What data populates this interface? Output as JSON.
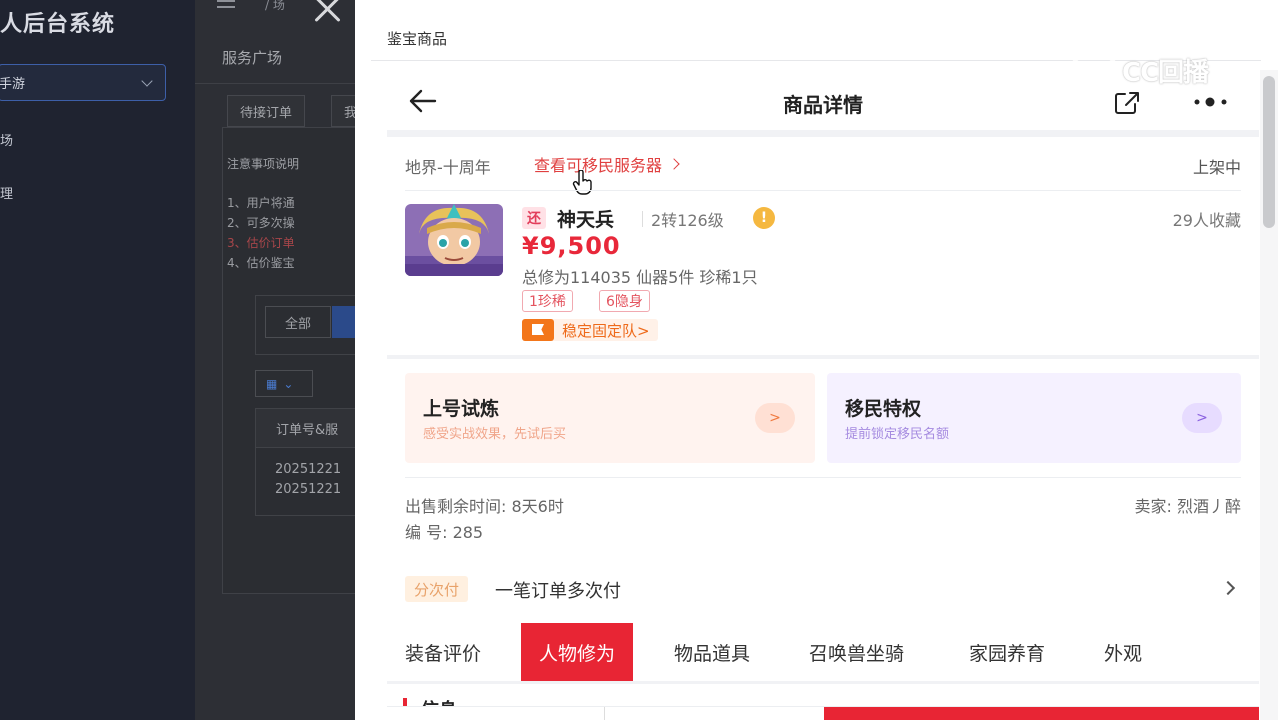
{
  "admin": {
    "title": "人后台系统",
    "game_select": "手游",
    "side_items": [
      "场",
      "理"
    ],
    "breadcrumb": "/ 场",
    "section_title": "服务广场",
    "tabs": [
      "待接订单",
      "我"
    ],
    "notice_title": "注意事项说明",
    "notices": [
      "1、用户将通",
      "2、可多次操",
      "3、估价订单",
      "4、估价鉴宝"
    ],
    "filter_all": "全部",
    "table_header": "订单号&服",
    "orders": [
      "20251221",
      "20251221"
    ]
  },
  "drawer": {
    "title": "鉴宝商品"
  },
  "product": {
    "nav_title": "商品详情",
    "server": "地界-十周年",
    "server_link": "查看可移民服务器",
    "status": "上架中",
    "badge": "还",
    "char_name": "神天兵",
    "level": "2转126级",
    "warn": "!",
    "favorites": "29人收藏",
    "price": "¥9,500",
    "stats": "总修为114035  仙器5件  珍稀1只",
    "tags": [
      "1珍稀",
      "6隐身"
    ],
    "team_tag": "稳定固定队>",
    "trial_title": "上号试炼",
    "trial_sub": "感受实战效果，先试后买",
    "migrate_title": "移民特权",
    "migrate_sub": "提前锁定移民名额",
    "circle_arrow": ">",
    "sale_time": "出售剩余时间: 8天6时",
    "seller": "卖家: 烈酒丿醉",
    "serial": "编 号: 285",
    "pay_badge": "分次付",
    "pay_text": "一笔订单多次付",
    "tabs": [
      "装备评价",
      "人物修为",
      "物品道具",
      "召唤兽坐骑",
      "家园养育",
      "外观"
    ],
    "info_label": "信息"
  },
  "watermark": {
    "text": "CC回播"
  },
  "colors": {
    "accent_red": "#e82534",
    "orange": "#f3761a"
  }
}
